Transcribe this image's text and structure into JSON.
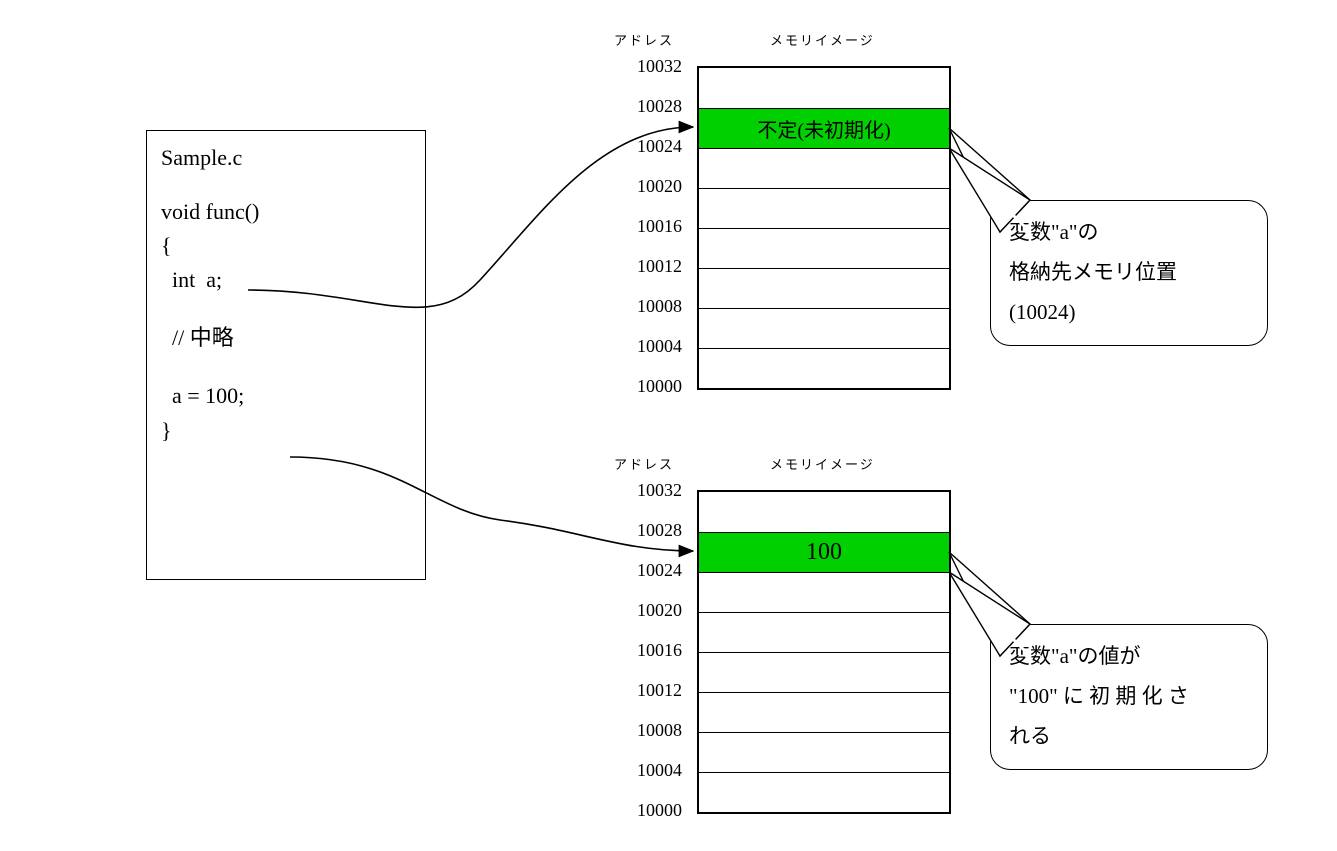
{
  "code": {
    "title": "Sample.c",
    "line_func": "void func()",
    "line_open": "{",
    "line_decl": "  int  a;",
    "line_comment": "  // 中略",
    "line_assign": "  a = 100;",
    "line_close": "}"
  },
  "headers": {
    "address": "アドレス",
    "memimg": "メモリイメージ"
  },
  "mem1": {
    "addresses": [
      "10032",
      "10028",
      "10024",
      "10020",
      "10016",
      "10012",
      "10008",
      "10004",
      "10000"
    ],
    "highlight_text": "不定(未初期化)",
    "callout_l1": "変数\"a\"の",
    "callout_l2": "格納先メモリ位置",
    "callout_l3": "(10024)"
  },
  "mem2": {
    "addresses": [
      "10032",
      "10028",
      "10024",
      "10020",
      "10016",
      "10012",
      "10008",
      "10004",
      "10000"
    ],
    "highlight_text": "100",
    "callout_l1": "変数\"a\"の値が",
    "callout_l2": "\"100\" に 初 期 化 さ",
    "callout_l3": "れる"
  }
}
